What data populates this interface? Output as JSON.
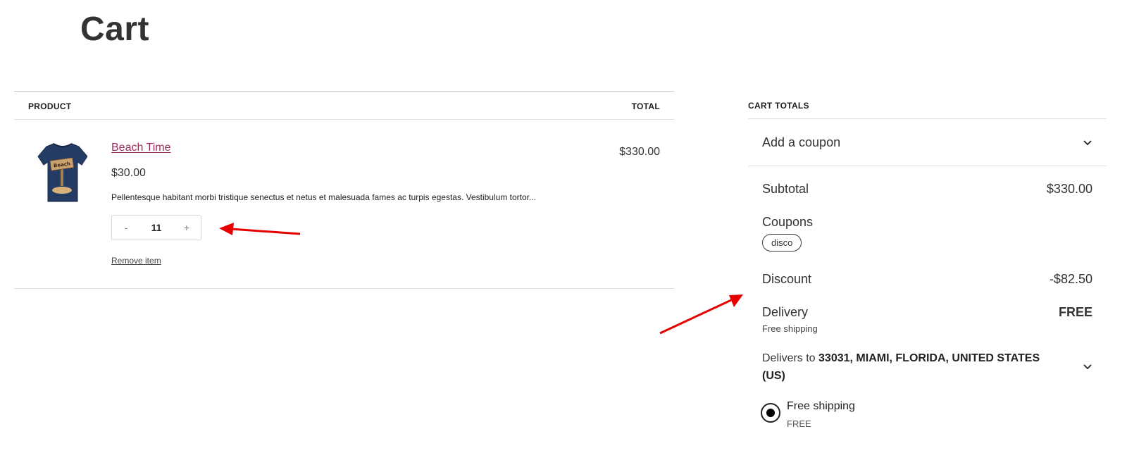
{
  "page": {
    "title": "Cart"
  },
  "table": {
    "header_product": "PRODUCT",
    "header_total": "TOTAL"
  },
  "item": {
    "name": "Beach Time",
    "price": "$30.00",
    "description": "Pellentesque habitant morbi tristique senectus et netus et malesuada fames ac turpis egestas. Vestibulum tortor...",
    "quantity": "11",
    "decrement_label": "-",
    "increment_label": "+",
    "line_total": "$330.00",
    "remove_label": "Remove item",
    "image_icon": "tshirt-icon",
    "image_text": "Beach",
    "image_color": "#243c63"
  },
  "totals": {
    "title": "CART TOTALS",
    "coupon_toggle": "Add a coupon",
    "subtotal_label": "Subtotal",
    "subtotal_value": "$330.00",
    "coupons_label": "Coupons",
    "coupon_code": "disco",
    "discount_label": "Discount",
    "discount_value": "-$82.50",
    "delivery_label": "Delivery",
    "delivery_value": "FREE",
    "delivery_sub": "Free shipping",
    "delivers_to_prefix": "Delivers to",
    "delivers_to_address": "33031, MIAMI, FLORIDA, UNITED STATES (US)",
    "shipping_option_label": "Free shipping",
    "shipping_option_price": "FREE"
  },
  "colors": {
    "link": "#9e2a5a",
    "annotation_arrow": "#e60000"
  }
}
